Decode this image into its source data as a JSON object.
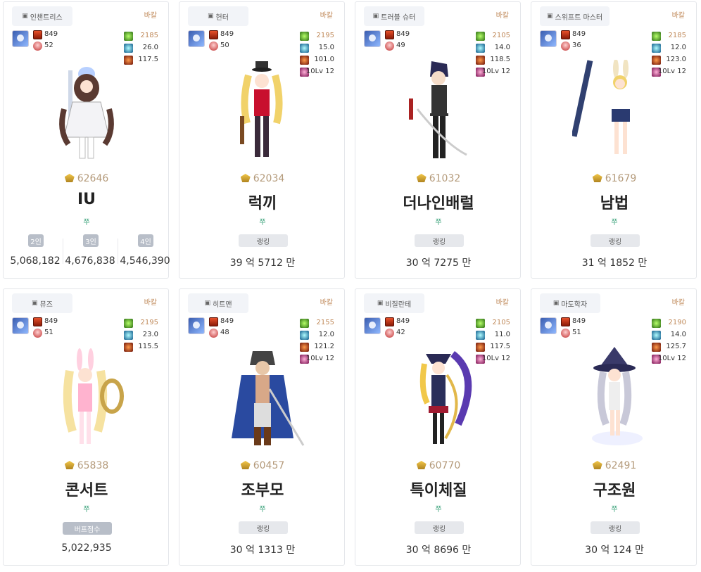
{
  "server_label": "바칼",
  "ranking_label": "랭킹",
  "cards": [
    {
      "job": "인챈트리스",
      "fame": "849",
      "level": "52",
      "stats": [
        {
          "icon": "green",
          "value": "2185"
        },
        {
          "icon": "blue",
          "value": "26.0"
        },
        {
          "icon": "red",
          "value": "117.5"
        }
      ],
      "score": "62646",
      "name": "IU",
      "guild": "쭈",
      "type": "party",
      "party": [
        {
          "label": "2인",
          "value": "5,068,182"
        },
        {
          "label": "3인",
          "value": "4,676,838"
        },
        {
          "label": "4인",
          "value": "4,546,390"
        }
      ],
      "sprite": "white-dress"
    },
    {
      "job": "헌터",
      "fame": "849",
      "level": "50",
      "stats": [
        {
          "icon": "green",
          "value": "2195"
        },
        {
          "icon": "blue",
          "value": "15.0"
        },
        {
          "icon": "red",
          "value": "101.0"
        },
        {
          "icon": "pink",
          "value": "10Lv 12"
        }
      ],
      "score": "62034",
      "name": "럭끼",
      "guild": "쭈",
      "type": "rank",
      "value": "39 억 5712 만",
      "sprite": "blonde-hunter"
    },
    {
      "job": "트러블 슈터",
      "fame": "849",
      "level": "49",
      "stats": [
        {
          "icon": "green",
          "value": "2105"
        },
        {
          "icon": "blue",
          "value": "14.0"
        },
        {
          "icon": "red",
          "value": "118.5"
        },
        {
          "icon": "pink",
          "value": "10Lv 12"
        }
      ],
      "score": "61032",
      "name": "더나인배럴",
      "guild": "쭈",
      "type": "rank",
      "value": "30 억 7275 만",
      "sprite": "vest-swordsman"
    },
    {
      "job": "스위프트 마스터",
      "fame": "849",
      "level": "36",
      "stats": [
        {
          "icon": "green",
          "value": "2185"
        },
        {
          "icon": "blue",
          "value": "12.0"
        },
        {
          "icon": "red",
          "value": "123.0"
        },
        {
          "icon": "pink",
          "value": "10Lv 12"
        }
      ],
      "score": "61679",
      "name": "남법",
      "guild": "쭈",
      "type": "rank",
      "value": "31 억 1852 만",
      "sprite": "bunny-staff"
    },
    {
      "job": "뮤즈",
      "fame": "849",
      "level": "51",
      "stats": [
        {
          "icon": "green",
          "value": "2195"
        },
        {
          "icon": "blue",
          "value": "23.0"
        },
        {
          "icon": "red",
          "value": "115.5"
        }
      ],
      "score": "65838",
      "name": "콘서트",
      "guild": "쭈",
      "type": "buff",
      "buff_label": "버프점수",
      "value": "5,022,935",
      "sprite": "bunny-muse"
    },
    {
      "job": "히트맨",
      "fame": "849",
      "level": "48",
      "stats": [
        {
          "icon": "green",
          "value": "2155"
        },
        {
          "icon": "blue",
          "value": "12.0"
        },
        {
          "icon": "red",
          "value": "121.2"
        },
        {
          "icon": "pink",
          "value": "10Lv 12"
        }
      ],
      "score": "60457",
      "name": "조부모",
      "guild": "쭈",
      "type": "rank",
      "value": "30 억 1313 만",
      "sprite": "blue-coat"
    },
    {
      "job": "비질란테",
      "fame": "849",
      "level": "42",
      "stats": [
        {
          "icon": "green",
          "value": "2105"
        },
        {
          "icon": "blue",
          "value": "11.0"
        },
        {
          "icon": "red",
          "value": "117.5"
        },
        {
          "icon": "pink",
          "value": "10Lv 12"
        }
      ],
      "score": "60770",
      "name": "특이체질",
      "guild": "쭈",
      "type": "rank",
      "value": "30 억 8696 만",
      "sprite": "pirate-girl"
    },
    {
      "job": "마도학자",
      "fame": "849",
      "level": "51",
      "stats": [
        {
          "icon": "green",
          "value": "2190"
        },
        {
          "icon": "blue",
          "value": "14.0"
        },
        {
          "icon": "red",
          "value": "125.7"
        },
        {
          "icon": "pink",
          "value": "10Lv 12"
        }
      ],
      "score": "62491",
      "name": "구조원",
      "guild": "쭈",
      "type": "rank",
      "value": "30 억 124 만",
      "sprite": "witch"
    }
  ]
}
